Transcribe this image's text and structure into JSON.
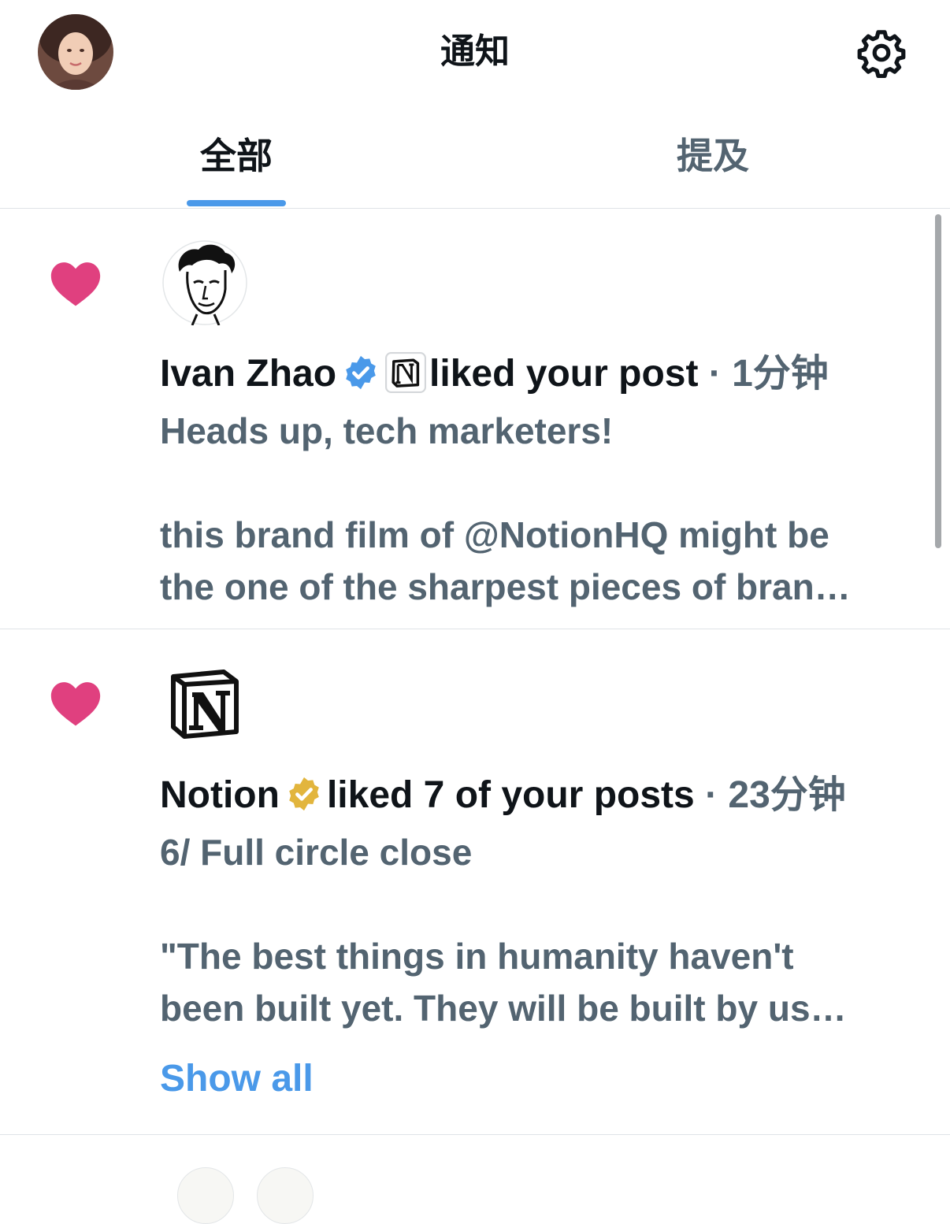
{
  "header": {
    "title": "通知",
    "avatar_icon": "user-avatar-photo",
    "settings_icon": "gear-icon"
  },
  "tabs": [
    {
      "label": "全部",
      "active": true
    },
    {
      "label": "提及",
      "active": false
    }
  ],
  "colors": {
    "accent": "#4a99e9",
    "heart": "#e0407f",
    "text_primary": "#0f1419",
    "text_secondary": "#536471",
    "divider": "#dfe3e7",
    "verified_blue": "#4a99e9",
    "verified_gold": "#e2b53d"
  },
  "notifications": [
    {
      "type": "like",
      "icon": "heart-icon",
      "actor": "Ivan Zhao",
      "badge": "blue-verified-icon",
      "affiliation_icon": "notion-logo-icon",
      "action": "liked your post",
      "separator": "·",
      "time": "1分钟",
      "preview_lines": [
        "Heads up, tech marketers!",
        "",
        "this brand film of @NotionHQ might be",
        "the one of the sharpest pieces of bran…"
      ]
    },
    {
      "type": "like",
      "icon": "heart-icon",
      "actor": "Notion",
      "badge": "gold-verified-icon",
      "action": "liked 7 of your posts",
      "separator": "·",
      "time": "23分钟",
      "preview_lines": [
        "6/ Full circle close",
        "",
        "\"The best things in humanity haven't",
        "been built yet. They will be built by us…"
      ],
      "show_all": "Show all"
    }
  ]
}
